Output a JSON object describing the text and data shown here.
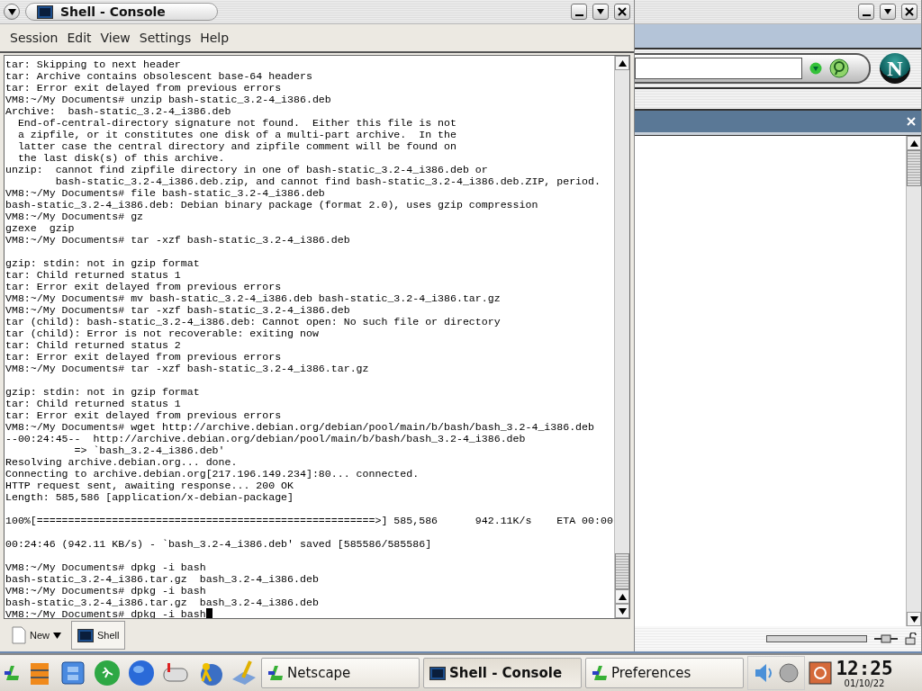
{
  "console": {
    "title": "Shell - Console",
    "menu": [
      "Session",
      "Edit",
      "View",
      "Settings",
      "Help"
    ],
    "lines": [
      {
        "kind": "text",
        "text": "tar: Skipping to next header"
      },
      {
        "kind": "text",
        "text": "tar: Archive contains obsolescent base-64 headers"
      },
      {
        "kind": "text",
        "text": "tar: Error exit delayed from previous errors"
      },
      {
        "kind": "text",
        "text": "VM8:~/My Documents# unzip bash-static_3.2-4_i386.deb"
      },
      {
        "kind": "text",
        "text": "Archive:  bash-static_3.2-4_i386.deb"
      },
      {
        "kind": "text",
        "text": "  End-of-central-directory signature not found.  Either this file is not"
      },
      {
        "kind": "text",
        "text": "  a zipfile, or it constitutes one disk of a multi-part archive.  In the"
      },
      {
        "kind": "text",
        "text": "  latter case the central directory and zipfile comment will be found on"
      },
      {
        "kind": "text",
        "text": "  the last disk(s) of this archive."
      },
      {
        "kind": "text",
        "text": "unzip:  cannot find zipfile directory in one of bash-static_3.2-4_i386.deb or"
      },
      {
        "kind": "text",
        "text": "        bash-static_3.2-4_i386.deb.zip, and cannot find bash-static_3.2-4_i386.deb.ZIP, period."
      },
      {
        "kind": "text",
        "text": "VM8:~/My Documents# file bash-static_3.2-4_i386.deb"
      },
      {
        "kind": "text",
        "text": "bash-static_3.2-4_i386.deb: Debian binary package (format 2.0), uses gzip compression"
      },
      {
        "kind": "text",
        "text": "VM8:~/My Documents# gz"
      },
      {
        "kind": "text",
        "text": "gzexe  gzip"
      },
      {
        "kind": "text",
        "text": "VM8:~/My Documents# tar -xzf bash-static_3.2-4_i386.deb"
      },
      {
        "kind": "blank"
      },
      {
        "kind": "text",
        "text": "gzip: stdin: not in gzip format"
      },
      {
        "kind": "text",
        "text": "tar: Child returned status 1"
      },
      {
        "kind": "text",
        "text": "tar: Error exit delayed from previous errors"
      },
      {
        "kind": "text",
        "text": "VM8:~/My Documents# mv bash-static_3.2-4_i386.deb bash-static_3.2-4_i386.tar.gz"
      },
      {
        "kind": "text",
        "text": "VM8:~/My Documents# tar -xzf bash-static_3.2-4_i386.deb"
      },
      {
        "kind": "text",
        "text": "tar (child): bash-static_3.2-4_i386.deb: Cannot open: No such file or directory"
      },
      {
        "kind": "text",
        "text": "tar (child): Error is not recoverable: exiting now"
      },
      {
        "kind": "text",
        "text": "tar: Child returned status 2"
      },
      {
        "kind": "text",
        "text": "tar: Error exit delayed from previous errors"
      },
      {
        "kind": "text",
        "text": "VM8:~/My Documents# tar -xzf bash-static_3.2-4_i386.tar.gz"
      },
      {
        "kind": "blank"
      },
      {
        "kind": "text",
        "text": "gzip: stdin: not in gzip format"
      },
      {
        "kind": "text",
        "text": "tar: Child returned status 1"
      },
      {
        "kind": "text",
        "text": "tar: Error exit delayed from previous errors"
      },
      {
        "kind": "text",
        "text": "VM8:~/My Documents# wget http://archive.debian.org/debian/pool/main/b/bash/bash_3.2-4_i386.deb"
      },
      {
        "kind": "text",
        "text": "--00:24:45--  http://archive.debian.org/debian/pool/main/b/bash/bash_3.2-4_i386.deb"
      },
      {
        "kind": "text",
        "text": "           => `bash_3.2-4_i386.deb'"
      },
      {
        "kind": "text",
        "text": "Resolving archive.debian.org... done."
      },
      {
        "kind": "text",
        "text": "Connecting to archive.debian.org[217.196.149.234]:80... connected."
      },
      {
        "kind": "text",
        "text": "HTTP request sent, awaiting response... 200 OK"
      },
      {
        "kind": "text",
        "text": "Length: 585,586 [application/x-debian-package]"
      },
      {
        "kind": "blank"
      },
      {
        "kind": "text",
        "text": "100%[======================================================>] 585,586      942.11K/s    ETA 00:00"
      },
      {
        "kind": "blank"
      },
      {
        "kind": "text",
        "text": "00:24:46 (942.11 KB/s) - `bash_3.2-4_i386.deb' saved [585586/585586]"
      },
      {
        "kind": "blank"
      },
      {
        "kind": "text",
        "text": "VM8:~/My Documents# dpkg -i bash"
      },
      {
        "kind": "text",
        "text": "bash-static_3.2-4_i386.tar.gz  bash_3.2-4_i386.deb"
      },
      {
        "kind": "text",
        "text": "VM8:~/My Documents# dpkg -i bash"
      },
      {
        "kind": "text",
        "text": "bash-static_3.2-4_i386.tar.gz  bash_3.2-4_i386.deb"
      },
      {
        "kind": "text",
        "text": "VM8:~/My Documents# dpkg -i bash",
        "cursor": true
      }
    ],
    "tabs": [
      {
        "label": "New",
        "kind": "new"
      },
      {
        "label": "Shell",
        "kind": "session"
      }
    ]
  },
  "browser": {
    "logo": "N"
  },
  "taskbar": {
    "tasks": [
      {
        "label": "Netscape",
        "kind": "app",
        "selected": false
      },
      {
        "label": "Shell - Console",
        "kind": "terminal",
        "selected": true
      },
      {
        "label": "Preferences",
        "kind": "app",
        "selected": false
      }
    ],
    "clock": {
      "time": "12:25",
      "date": "01/10/22"
    }
  }
}
